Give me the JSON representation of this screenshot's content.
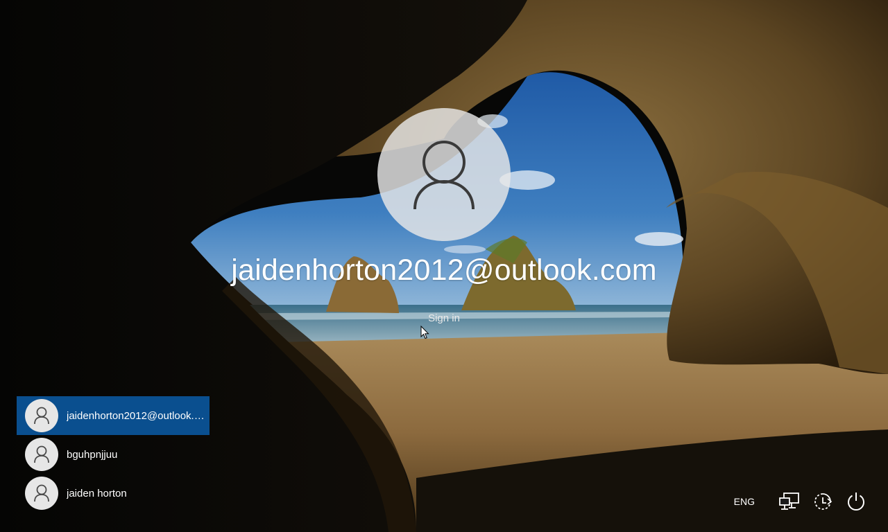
{
  "lock_screen": {
    "account_name": "jaidenhorton2012@outlook.com",
    "sign_in_label": "Sign in"
  },
  "user_list": [
    {
      "label": "jaidenhorton2012@outlook.com",
      "selected": true
    },
    {
      "label": "bguhpnjjuu",
      "selected": false
    },
    {
      "label": "jaiden horton",
      "selected": false
    }
  ],
  "tray": {
    "language": "ENG",
    "icons": [
      "network-icon",
      "ease-of-access-icon",
      "power-icon"
    ]
  },
  "colors": {
    "selected_user": "#0a4f8f",
    "text": "#ffffff"
  }
}
